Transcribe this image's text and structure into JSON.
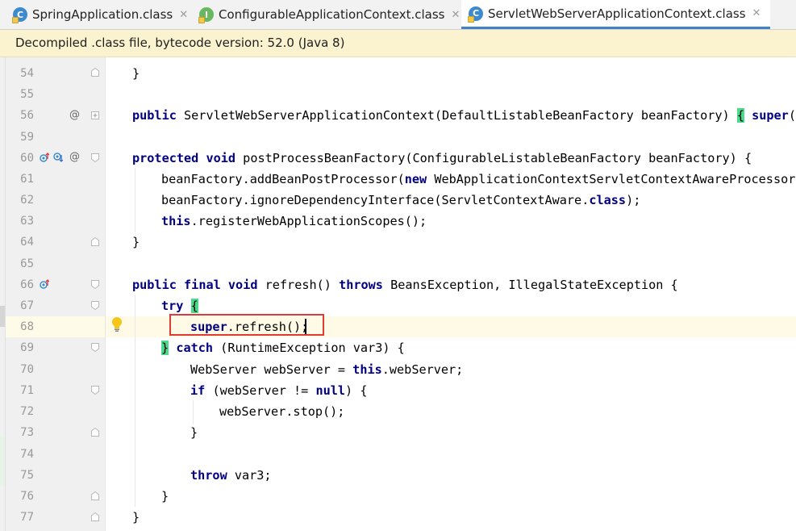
{
  "tabs": [
    {
      "label": "SpringApplication.class",
      "icon": "class-icon",
      "active": false
    },
    {
      "label": "ConfigurableApplicationContext.class",
      "icon": "interface-icon",
      "active": false
    },
    {
      "label": "ServletWebServerApplicationContext.class",
      "icon": "class-icon",
      "active": true
    }
  ],
  "banner": {
    "text": "Decompiled .class file, bytecode version: 52.0 (Java 8)"
  },
  "gutter": {
    "line_numbers": [
      "54",
      "55",
      "56",
      "59",
      "60",
      "61",
      "62",
      "63",
      "64",
      "65",
      "66",
      "67",
      "68",
      "69",
      "70",
      "71",
      "72",
      "73",
      "74",
      "75",
      "76",
      "77"
    ],
    "markers": {
      "at_symbol": "@"
    }
  },
  "code": {
    "l54": "}",
    "l56_kw": "public",
    "l56_rest": " ServletWebServerApplicationContext(DefaultListableBeanFactory beanFactory) ",
    "l56_brace": "{",
    "l56_kw2": "super",
    "l56_tail": "(be",
    "l60_kw1": "protected",
    "l60_kw2": "void",
    "l60_rest": " postProcessBeanFactory(ConfigurableListableBeanFactory beanFactory) {",
    "l61_pre": "beanFactory.addBeanPostProcessor(",
    "l61_kw": "new",
    "l61_rest": " WebApplicationContextServletContextAwareProcessor(t",
    "l62_pre": "beanFactory.ignoreDependencyInterface(ServletContextAware.",
    "l62_kw": "class",
    "l62_rest": ");",
    "l63_kw": "this",
    "l63_rest": ".registerWebApplicationScopes();",
    "l64": "}",
    "l66_kw1": "public",
    "l66_kw2": "final",
    "l66_kw3": "void",
    "l66_mid": " refresh() ",
    "l66_kw4": "throws",
    "l66_rest": " BeansException, IllegalStateException {",
    "l67_kw": "try",
    "l67_brace": "{",
    "l68_kw": "super",
    "l68_rest": ".refresh();",
    "l69_brace": "}",
    "l69_kw": "catch",
    "l69_rest": " (RuntimeException var3) {",
    "l70_pre": "WebServer webServer = ",
    "l70_kw": "this",
    "l70_rest": ".webServer;",
    "l71_kw": "if",
    "l71_mid": " (webServer != ",
    "l71_kw2": "null",
    "l71_rest": ") {",
    "l72": "webServer.stop();",
    "l73": "}",
    "l75_kw": "throw",
    "l75_rest": " var3;",
    "l76": "}",
    "l77": "}"
  },
  "colors": {
    "keyword": "#000080",
    "highlight_box": "#e03a35",
    "brace_match": "#4cd98a",
    "banner_bg": "#fbf3cf"
  }
}
